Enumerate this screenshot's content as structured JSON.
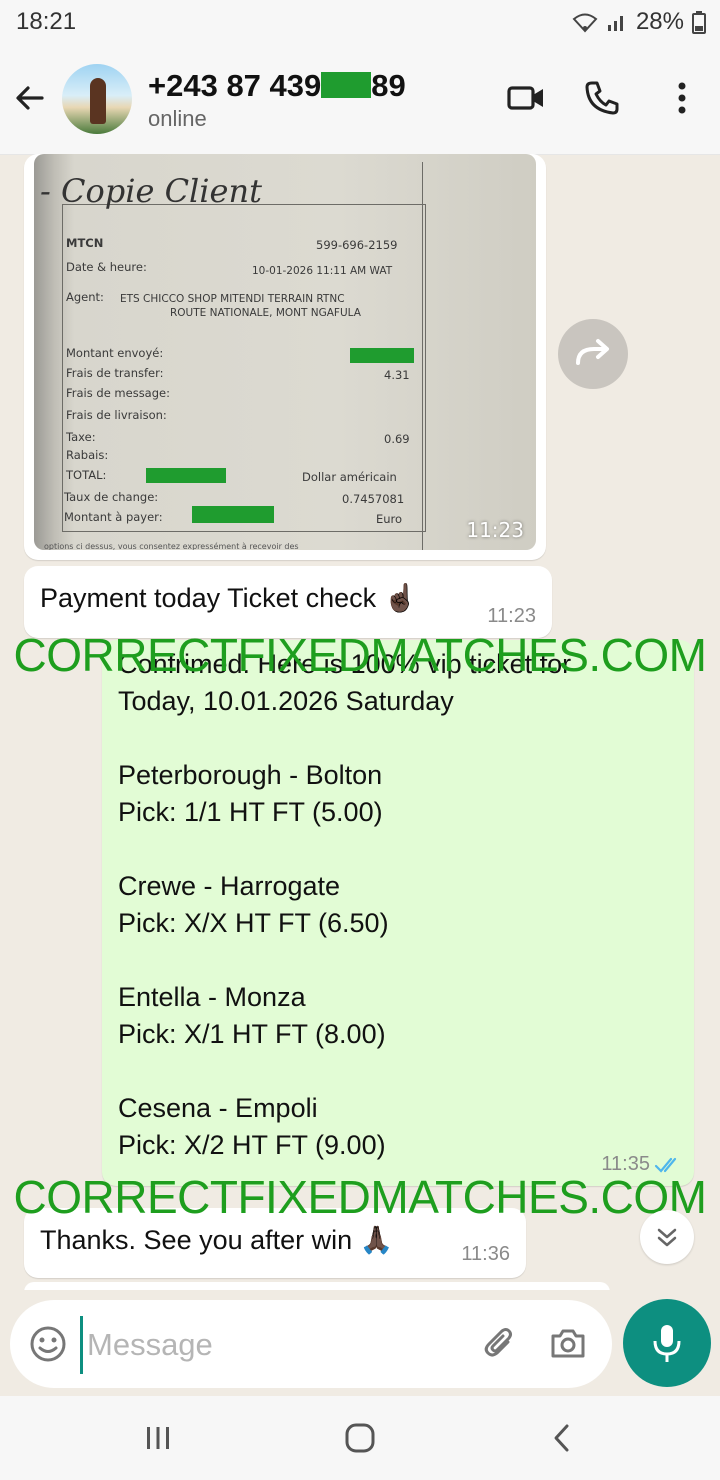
{
  "status_bar": {
    "time": "18:21",
    "battery": "28%"
  },
  "header": {
    "contact_prefix": "+243 87 439",
    "contact_suffix": "89",
    "contact_status": "online"
  },
  "receipt": {
    "title": "- Copie Client",
    "mtcn_label": "MTCN",
    "mtcn_value": "599-696-2159",
    "date_label": "Date & heure:",
    "date_value": "10-01-2026 11:11 AM WAT",
    "agent_label": "Agent:",
    "agent_line1": "ETS CHICCO SHOP MITENDI TERRAIN RTNC",
    "agent_line2": "ROUTE NATIONALE, MONT NGAFULA",
    "montant_envoye": "Montant envoyé:",
    "frais_transfer": "Frais de transfer:",
    "frais_transfer_value": "4.31",
    "frais_message": "Frais de message:",
    "frais_livraison": "Frais de livraison:",
    "taxe": "Taxe:",
    "taxe_value": "0.69",
    "rabais": "Rabais:",
    "total": "TOTAL:",
    "total_currency": "Dollar américain",
    "taux_change": "Taux de change:",
    "taux_value": "0.7457081",
    "montant_payer": "Montant à payer:",
    "payer_currency": "Euro",
    "footer": "options ci dessus, vous consentez expressément à recevoir des",
    "time": "11:23"
  },
  "messages": [
    {
      "text": "Payment today Ticket check ☝🏿",
      "time": "11:23"
    },
    {
      "text": "Confrimed. Here is 100% vip ticket for\nToday, 10.01.2026 Saturday\n\nPeterborough - Bolton\nPick: 1/1 HT FT (5.00)\n\nCrewe - Harrogate\nPick: X/X HT FT (6.50)\n\nEntella - Monza\nPick: X/1 HT FT (8.00)\n\nCesena - Empoli\nPick: X/2 HT FT (9.00)",
      "time": "11:35"
    },
    {
      "text": "Thanks. See you after win 🙏🏿",
      "time": "11:36"
    }
  ],
  "watermark": "CORRECTFIXEDMATCHES.COM",
  "composer": {
    "placeholder": "Message"
  },
  "colors": {
    "accent": "#0d8f80",
    "outgoing": "#e2fcd5",
    "watermark": "#1e9e1e",
    "redaction": "#1f9c2f"
  }
}
